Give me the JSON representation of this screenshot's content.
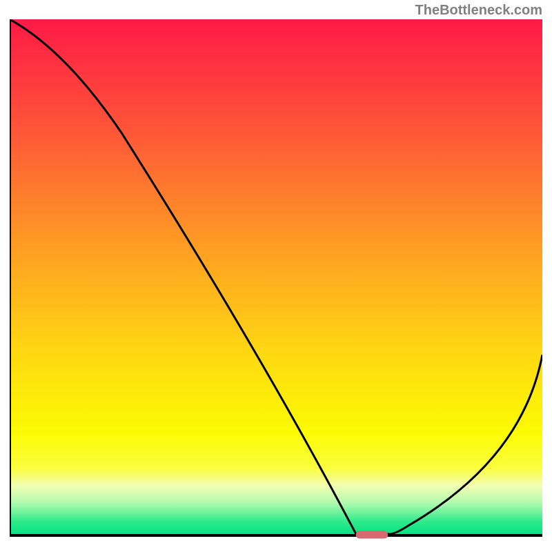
{
  "watermark": "TheBottleneck.com",
  "chart_data": {
    "type": "line",
    "title": "",
    "xlabel": "",
    "ylabel": "",
    "xlim": [
      0,
      100
    ],
    "ylim": [
      0,
      100
    ],
    "x": [
      0,
      21,
      65,
      71,
      75,
      100
    ],
    "y": [
      100,
      78,
      0,
      0,
      2,
      35
    ],
    "annotations": [
      {
        "type": "marker",
        "shape": "pill",
        "x_range": [
          65,
          71
        ],
        "y": 0,
        "color": "#d56a6f"
      }
    ],
    "background_gradient": {
      "stops": [
        {
          "offset": 0.0,
          "color": "#fe1a46"
        },
        {
          "offset": 0.2,
          "color": "#fe5139"
        },
        {
          "offset": 0.45,
          "color": "#fea022"
        },
        {
          "offset": 0.65,
          "color": "#fed911"
        },
        {
          "offset": 0.8,
          "color": "#fcfb03"
        },
        {
          "offset": 0.87,
          "color": "#fafe3f"
        },
        {
          "offset": 0.903,
          "color": "#f3feb1"
        },
        {
          "offset": 0.935,
          "color": "#b6fbb0"
        },
        {
          "offset": 0.958,
          "color": "#67f29a"
        },
        {
          "offset": 0.973,
          "color": "#2fea8c"
        },
        {
          "offset": 0.988,
          "color": "#15e586"
        },
        {
          "offset": 1.0,
          "color": "#01e280"
        }
      ]
    },
    "axis_color": "#000000",
    "line_color": "#000000"
  }
}
